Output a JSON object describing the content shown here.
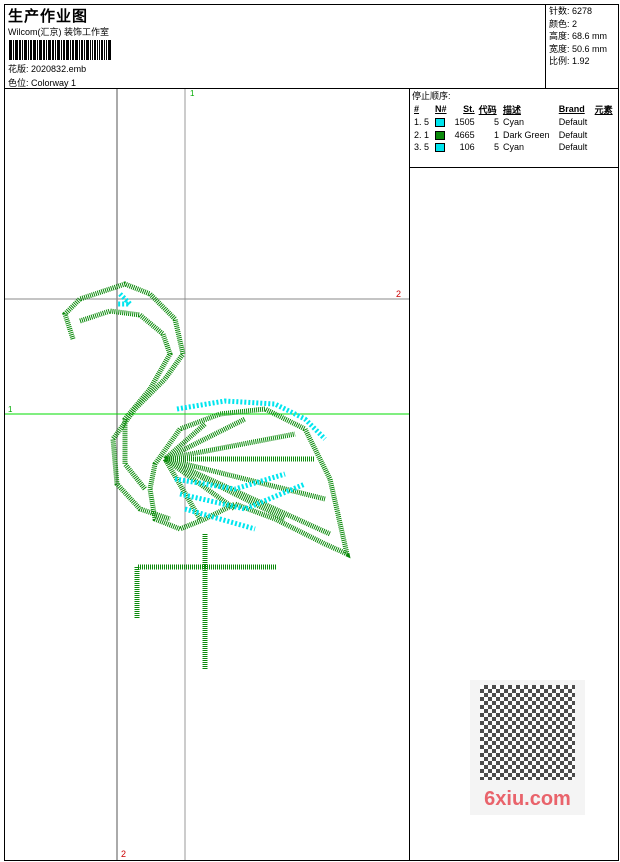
{
  "header": {
    "title": "生产作业图",
    "studio": "Wilcom(汇京) 装饰工作室",
    "design_label": "花版:",
    "design_value": "2020832.emb",
    "colorway_label": "色位:",
    "colorway_value": "Colorway 1"
  },
  "stats": [
    {
      "label": "针数:",
      "value": "6278"
    },
    {
      "label": "颜色:",
      "value": "2"
    },
    {
      "label": "高度:",
      "value": "68.6 mm"
    },
    {
      "label": "宽度:",
      "value": "50.6 mm"
    },
    {
      "label": "比例:",
      "value": "1.92"
    }
  ],
  "stop_sequence": {
    "title": "停止顺序:",
    "columns": [
      "#",
      "N#",
      "St.",
      "代码",
      "描述",
      "Brand",
      "元素"
    ],
    "rows": [
      {
        "idx": "1.",
        "n": "5",
        "color": "#00e5ee",
        "st": "1505",
        "code": "5",
        "desc": "Cyan",
        "brand": "Default"
      },
      {
        "idx": "2.",
        "n": "1",
        "color": "#0a8a0a",
        "st": "4665",
        "code": "1",
        "desc": "Dark Green",
        "brand": "Default"
      },
      {
        "idx": "3.",
        "n": "5",
        "color": "#00e5ee",
        "st": "106",
        "code": "5",
        "desc": "Cyan",
        "brand": "Default"
      }
    ]
  },
  "canvas": {
    "markers": {
      "top": "1",
      "left": "1",
      "right": "2",
      "bottom": "2"
    }
  },
  "watermark": {
    "text": "6xiu.com"
  }
}
